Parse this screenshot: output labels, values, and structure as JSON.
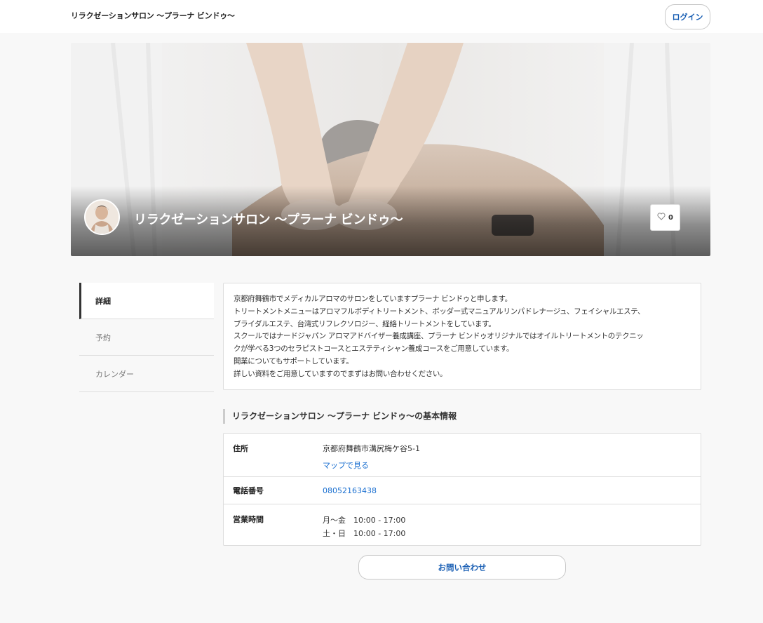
{
  "header": {
    "site_title": "リラクゼーションサロン ～プラーナ ビンドゥ～",
    "login_label": "ログイン"
  },
  "hero": {
    "title": "リラクゼーションサロン ～プラーナ ビンドゥ～",
    "like_count": "0"
  },
  "nav": {
    "items": [
      {
        "label": "詳細"
      },
      {
        "label": "予約"
      },
      {
        "label": "カレンダー"
      }
    ]
  },
  "description": {
    "lines": [
      "京都府舞鶴市でメディカルアロマのサロンをしていますプラーナ ビンドゥと申します。",
      "トリートメントメニューはアロマフルボディトリートメント、ボッダー式マニュアルリンパドレナージュ、フェイシャルエステ、",
      "ブライダルエステ、台湾式リフレクソロジー、経絡トリートメントをしています。",
      "スクールではナードジャパン アロマアドバイザー養成講座、プラーナ ビンドゥオリジナルではオイルトリートメントのテクニッ",
      "クが学べる3つのセラピストコースとエステティシャン養成コースをご用意しています。",
      "開業についてもサポートしています。",
      "詳しい資料をご用意していますのでまずはお問い合わせください。"
    ]
  },
  "info": {
    "heading": "リラクゼーションサロン ～プラーナ ビンドゥ～の基本情報",
    "address_label": "住所",
    "address_value": "京都府舞鶴市溝尻梅ケ谷5-1",
    "map_link": "マップで見る",
    "phone_label": "電話番号",
    "phone_value": "08052163438",
    "hours_label": "営業時間",
    "hours": [
      {
        "days": "月～金",
        "time": "10:00 - 17:00"
      },
      {
        "days": "土・日",
        "time": "10:00 - 17:00"
      }
    ]
  },
  "contact_label": "お問い合わせ",
  "colors": {
    "accent_link": "#1a6fd0",
    "page_bg": "#f8f8f8"
  },
  "icons": {
    "like": "heart-outline-icon"
  }
}
